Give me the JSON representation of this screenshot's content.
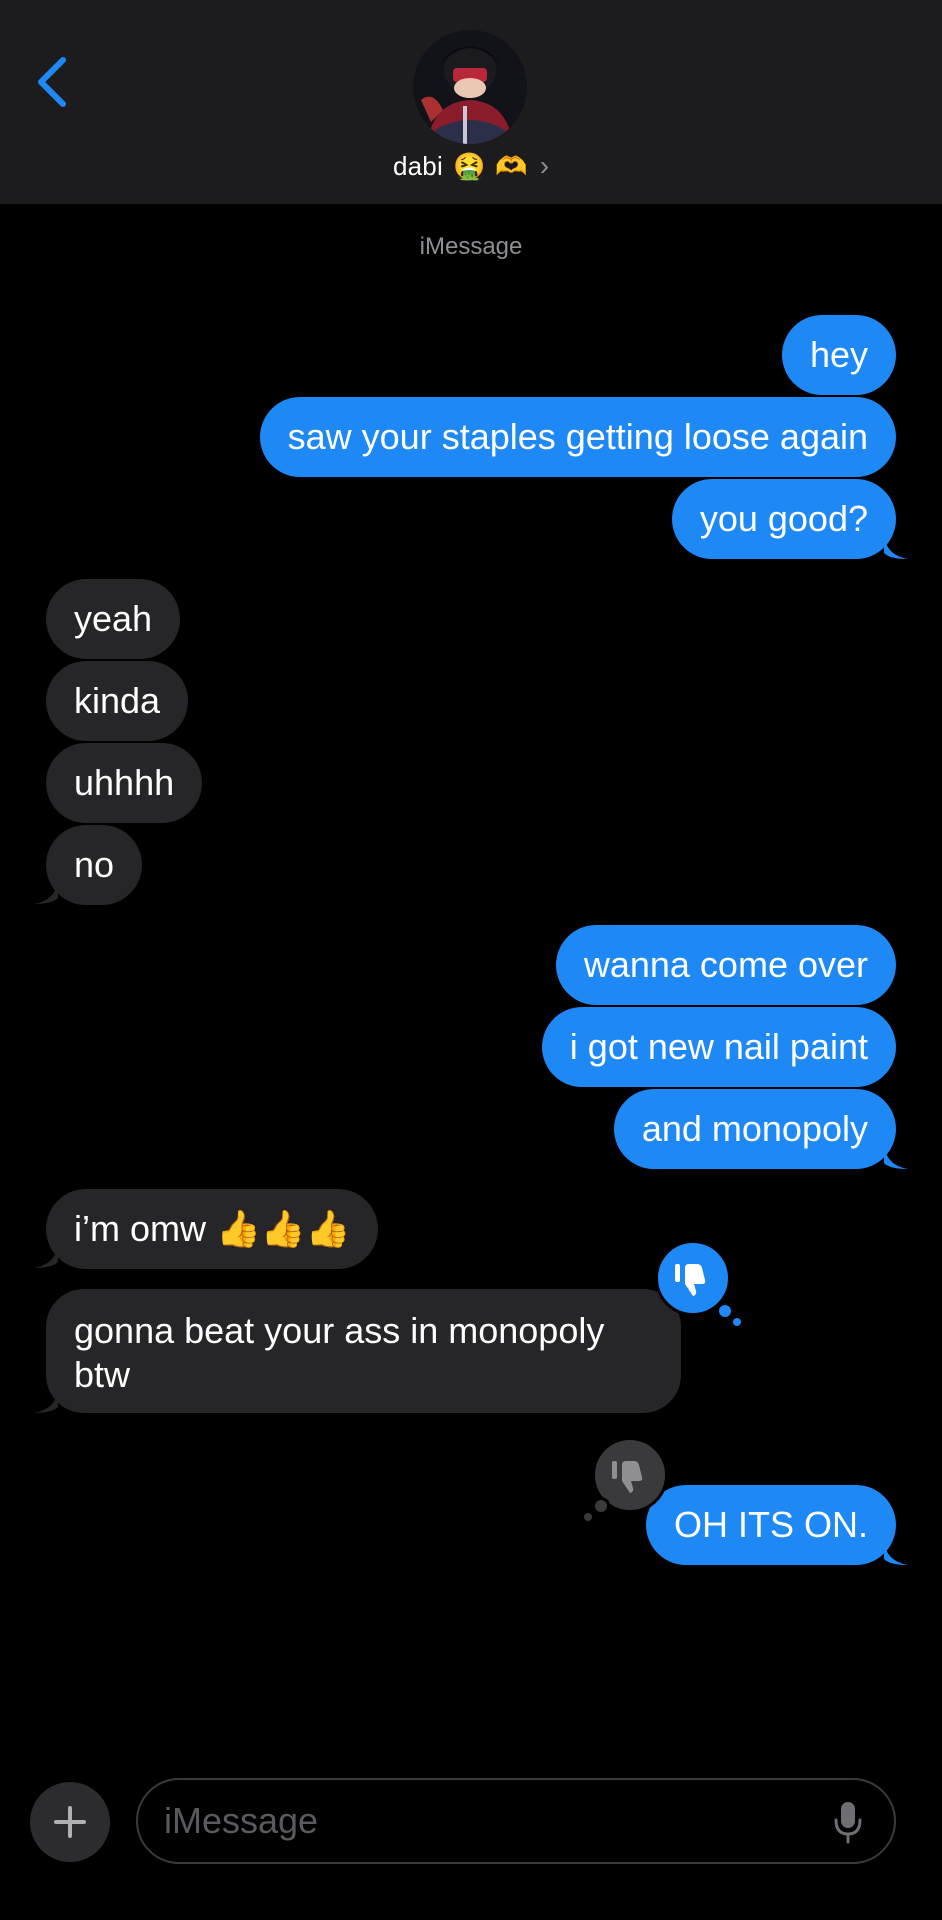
{
  "header": {
    "contact_name": "dabi",
    "emoji_1": "🤮",
    "emoji_2": "🫶",
    "chevron": "›",
    "back_icon": "chevron-left-icon"
  },
  "service_label": "iMessage",
  "messages": [
    {
      "from": "me",
      "text": "hey"
    },
    {
      "from": "me",
      "text": "saw your staples getting loose again"
    },
    {
      "from": "me",
      "text": "you good?"
    },
    {
      "from": "them",
      "text": "yeah"
    },
    {
      "from": "them",
      "text": "kinda"
    },
    {
      "from": "them",
      "text": "uhhhh"
    },
    {
      "from": "them",
      "text": "no"
    },
    {
      "from": "me",
      "text": "wanna come over"
    },
    {
      "from": "me",
      "text": "i got new nail paint"
    },
    {
      "from": "me",
      "text": "and monopoly"
    },
    {
      "from": "them",
      "text": "i’m omw 👍👍👍"
    },
    {
      "from": "them",
      "text": "gonna beat your ass in monopoly btw",
      "reaction": "thumbs-down",
      "reaction_by": "me"
    },
    {
      "from": "me",
      "text": "OH ITS ON.",
      "reaction": "thumbs-down",
      "reaction_by": "them"
    }
  ],
  "composer": {
    "placeholder": "iMessage",
    "plus_label": "+",
    "mic_icon": "microphone-icon"
  },
  "colors": {
    "outgoing_bubble": "#1e88f5",
    "incoming_bubble": "#262628",
    "header_bg": "#1c1c1e",
    "accent": "#1e88f5",
    "secondary_text": "#8e8e93"
  }
}
